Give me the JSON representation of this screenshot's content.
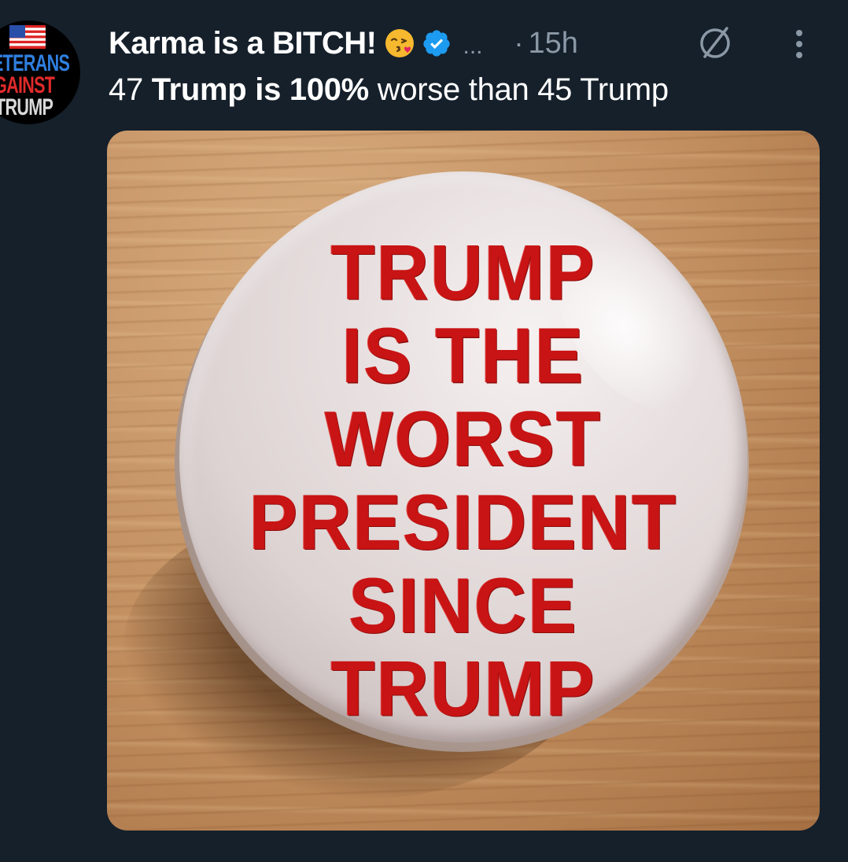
{
  "author": {
    "display_name": "Karma is a BITCH!",
    "emoji": "kissing-face-emoji",
    "verified": true,
    "handle_truncated": "...",
    "separator": "·",
    "timestamp": "15h",
    "avatar_logo_lines": [
      "ETERANS",
      "GAINST",
      "TRUMP"
    ]
  },
  "tweet": {
    "text_prefix": "47 ",
    "text_bold": "Trump is 100%",
    "text_suffix": " worse than 45 Trump"
  },
  "media": {
    "button_lines": [
      "TRUMP",
      "IS THE",
      "WORST",
      "PRESIDENT",
      "SINCE",
      "TRUMP"
    ]
  },
  "icons": {
    "verified": "verified-badge-icon",
    "grok": "grok-icon",
    "more": "more-options-icon"
  },
  "colors": {
    "background": "#15202b",
    "text_primary": "#ffffff",
    "text_secondary": "#8b98a5",
    "verified_blue": "#1d9bf0",
    "button_text_red": "#c81414"
  }
}
